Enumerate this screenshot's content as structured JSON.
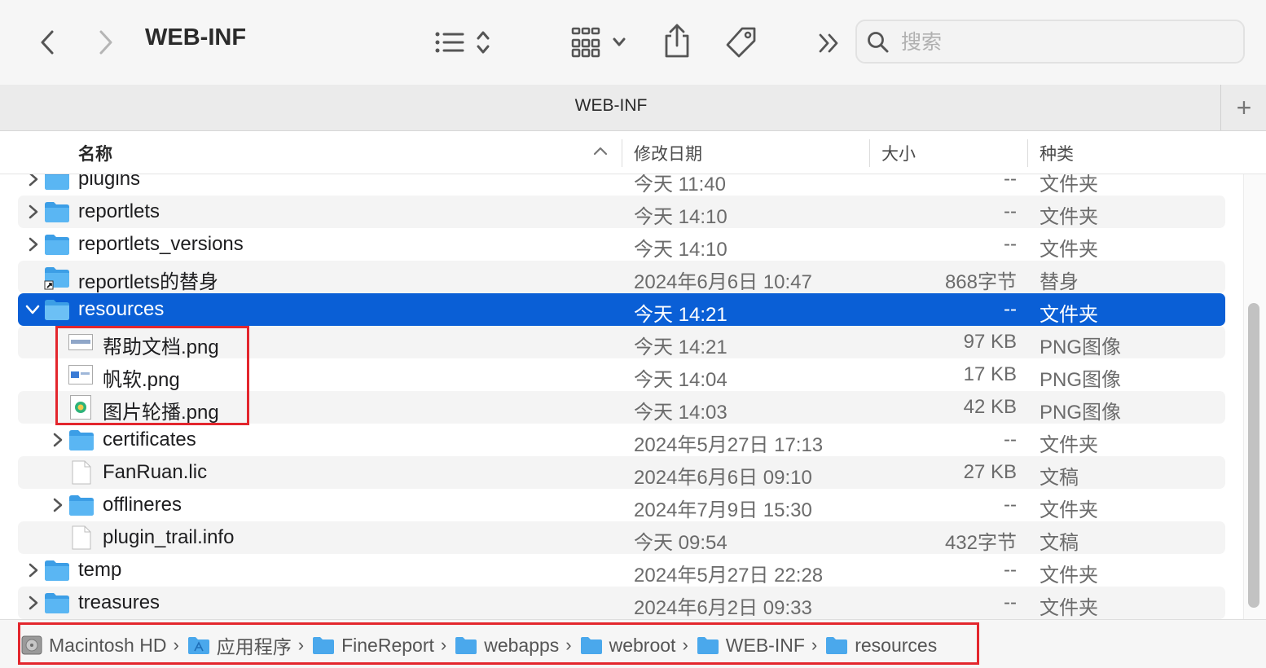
{
  "window": {
    "title": "WEB-INF",
    "tab_label": "WEB-INF",
    "search_placeholder": "搜索",
    "tab_add_label": "+"
  },
  "columns": {
    "name": "名称",
    "date": "修改日期",
    "size": "大小",
    "kind": "种类"
  },
  "rows": [
    {
      "name": "plugins",
      "date": "今天 11:40",
      "size": "--",
      "kind": "文件夹"
    },
    {
      "name": "reportlets",
      "date": "今天 14:10",
      "size": "--",
      "kind": "文件夹"
    },
    {
      "name": "reportlets_versions",
      "date": "今天 14:10",
      "size": "--",
      "kind": "文件夹"
    },
    {
      "name": "reportlets的替身",
      "date": "2024年6月6日 10:47",
      "size": "868字节",
      "kind": "替身"
    },
    {
      "name": "resources",
      "date": "今天 14:21",
      "size": "--",
      "kind": "文件夹"
    },
    {
      "name": "帮助文档.png",
      "date": "今天 14:21",
      "size": "97 KB",
      "kind": "PNG图像"
    },
    {
      "name": "帆软.png",
      "date": "今天 14:04",
      "size": "17 KB",
      "kind": "PNG图像"
    },
    {
      "name": "图片轮播.png",
      "date": "今天 14:03",
      "size": "42 KB",
      "kind": "PNG图像"
    },
    {
      "name": "certificates",
      "date": "2024年5月27日 17:13",
      "size": "--",
      "kind": "文件夹"
    },
    {
      "name": "FanRuan.lic",
      "date": "2024年6月6日 09:10",
      "size": "27 KB",
      "kind": "文稿"
    },
    {
      "name": "offlineres",
      "date": "2024年7月9日 15:30",
      "size": "--",
      "kind": "文件夹"
    },
    {
      "name": "plugin_trail.info",
      "date": "今天 09:54",
      "size": "432字节",
      "kind": "文稿"
    },
    {
      "name": "temp",
      "date": "2024年5月27日 22:28",
      "size": "--",
      "kind": "文件夹"
    },
    {
      "name": "treasures",
      "date": "2024年6月2日 09:33",
      "size": "--",
      "kind": "文件夹"
    }
  ],
  "path": [
    "Macintosh HD",
    "应用程序",
    "FineReport",
    "webapps",
    "webroot",
    "WEB-INF",
    "resources"
  ],
  "colors": {
    "selection": "#0a5fd6",
    "folder": "#4aa8ec",
    "highlight_box": "#e3262d"
  }
}
